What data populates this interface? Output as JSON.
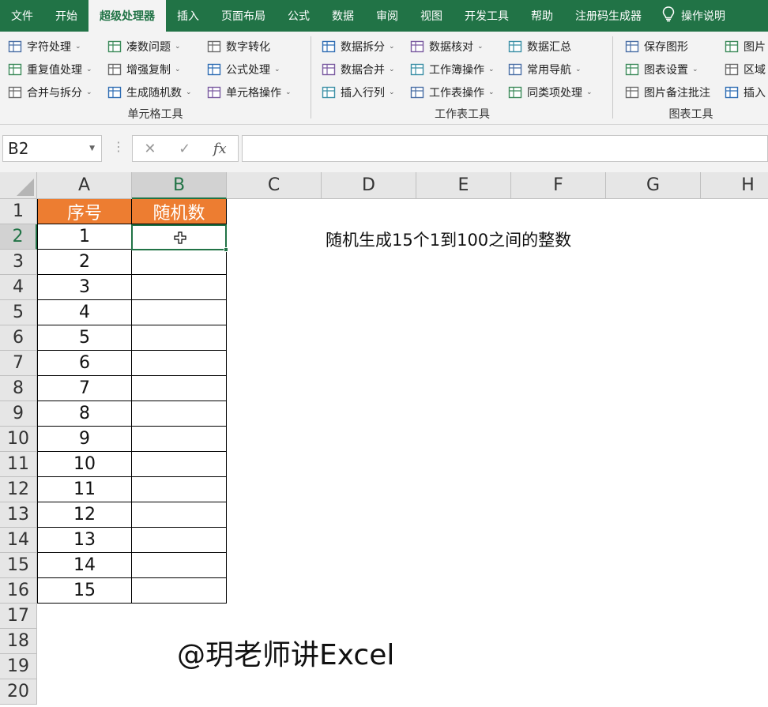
{
  "menu": {
    "tabs": [
      "文件",
      "开始",
      "超级处理器",
      "插入",
      "页面布局",
      "公式",
      "数据",
      "审阅",
      "视图",
      "开发工具",
      "帮助",
      "注册码生成器"
    ],
    "active_tab": "超级处理器",
    "help_label": "操作说明"
  },
  "ribbon": {
    "groups": [
      {
        "label": "单元格工具",
        "buttons": [
          [
            "字符处理",
            "重复值处理",
            "合并与拆分"
          ],
          [
            "凑数问题",
            "增强复制",
            "生成随机数"
          ],
          [
            "数字转化",
            "公式处理",
            "单元格操作"
          ]
        ]
      },
      {
        "label": "工作表工具",
        "buttons": [
          [
            "数据拆分",
            "数据合并",
            "插入行列"
          ],
          [
            "数据核对",
            "工作簿操作",
            "工作表操作"
          ],
          [
            "数据汇总",
            "常用导航",
            "同类项处理"
          ]
        ]
      },
      {
        "label": "图表工具",
        "buttons": [
          [
            "保存图形",
            "图表设置",
            "图片备注批注"
          ],
          [
            "图片",
            "区域",
            "插入"
          ]
        ]
      }
    ]
  },
  "formula_bar": {
    "name_box": "B2",
    "cancel_icon": "✕",
    "enter_icon": "✓",
    "fx_label": "fx",
    "formula": ""
  },
  "sheet": {
    "columns": [
      "A",
      "B",
      "C",
      "D",
      "E",
      "F",
      "G",
      "H"
    ],
    "selected_column": "B",
    "rows": [
      "1",
      "2",
      "3",
      "4",
      "5",
      "6",
      "7",
      "8",
      "9",
      "10",
      "11",
      "12",
      "13",
      "14",
      "15",
      "16",
      "17",
      "18",
      "19",
      "20"
    ],
    "selected_row": "2",
    "header_a": "序号",
    "header_b": "随机数",
    "serials": [
      "1",
      "2",
      "3",
      "4",
      "5",
      "6",
      "7",
      "8",
      "9",
      "10",
      "11",
      "12",
      "13",
      "14",
      "15"
    ],
    "note": "随机生成15个1到100之间的整数",
    "watermark": "@玥老师讲Excel",
    "header_fill": "#ed7d31",
    "accent": "#217346"
  }
}
